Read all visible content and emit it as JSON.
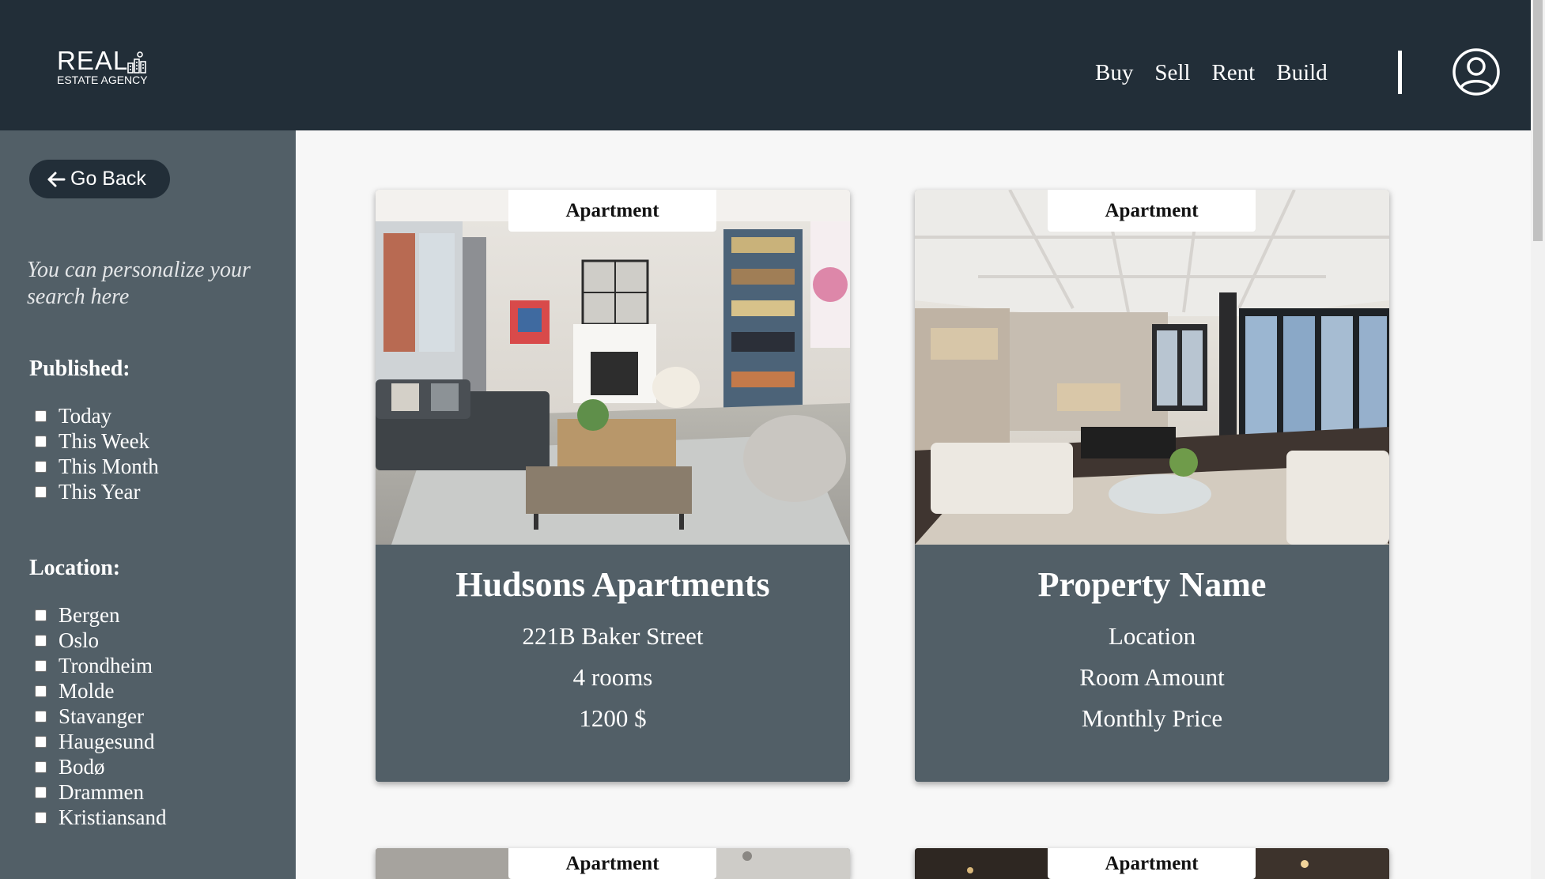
{
  "header": {
    "logo": {
      "line1": "REAL",
      "line2": "ESTATE AGENCY"
    },
    "nav": [
      "Buy",
      "Sell",
      "Rent",
      "Build"
    ],
    "icons": [
      "user-profile-icon"
    ]
  },
  "sidebar": {
    "back_label": "Go Back",
    "personalize_text": "You can personalize your search here",
    "published": {
      "title": "Published:",
      "options": [
        "Today",
        "This Week",
        "This Month",
        "This Year"
      ]
    },
    "location": {
      "title": "Location:",
      "options": [
        "Bergen",
        "Oslo",
        "Trondheim",
        "Molde",
        "Stavanger",
        "Haugesund",
        "Bodø",
        "Drammen",
        "Kristiansand"
      ]
    }
  },
  "listings": [
    {
      "type": "Apartment",
      "name": "Hudsons Apartments",
      "location": "221B Baker Street",
      "rooms": "4 rooms",
      "price": "1200 $"
    },
    {
      "type": "Apartment",
      "name": "Property Name",
      "location": "Location",
      "rooms": "Room Amount",
      "price": "Monthly Price"
    },
    {
      "type": "Apartment"
    },
    {
      "type": "Apartment"
    }
  ],
  "colors": {
    "header_bg": "#222e38",
    "sidebar_bg": "#525f67",
    "card_bg": "#525f67",
    "page_bg": "#f7f7f7"
  }
}
